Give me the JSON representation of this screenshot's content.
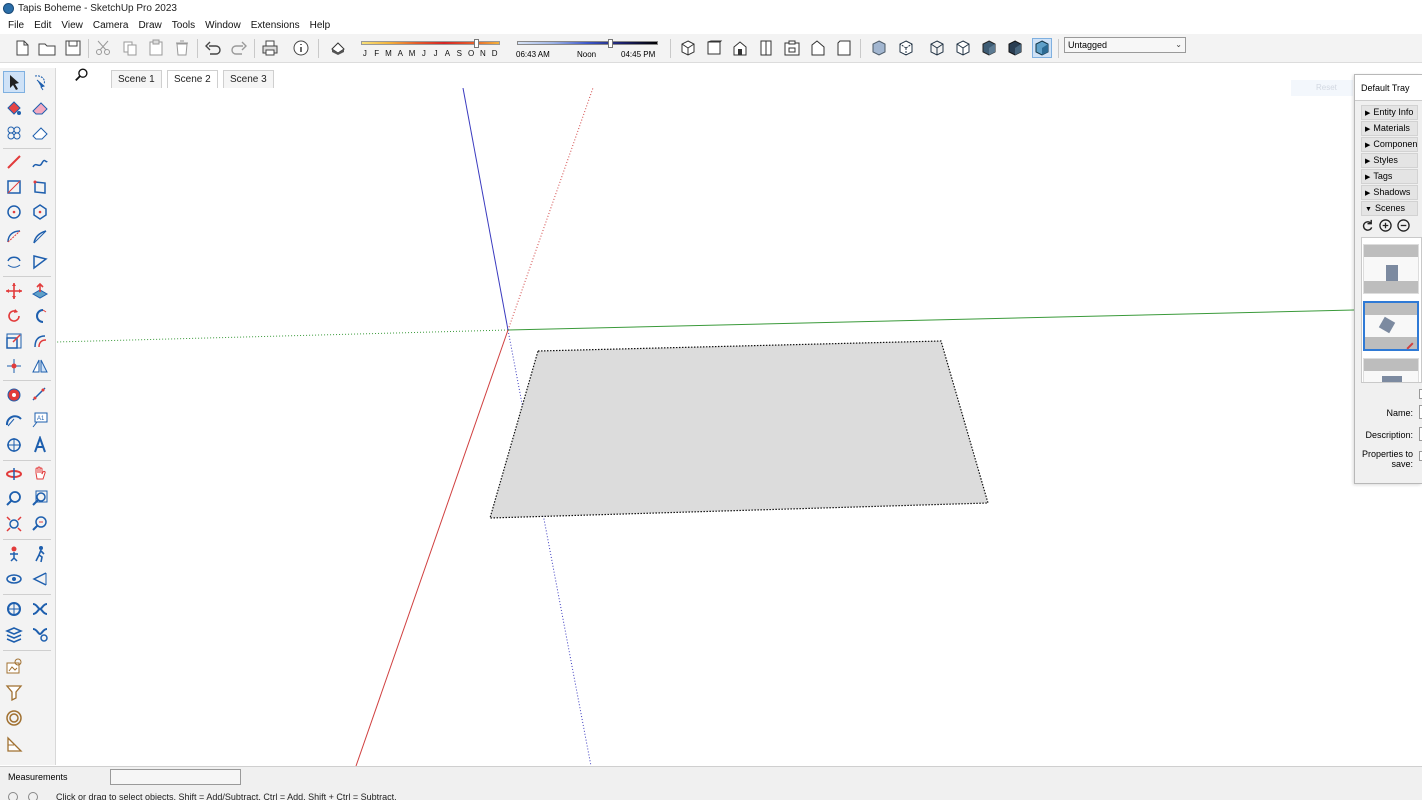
{
  "window": {
    "title": "Tapis Boheme - SketchUp Pro 2023"
  },
  "menubar": {
    "items": [
      "File",
      "Edit",
      "View",
      "Camera",
      "Draw",
      "Tools",
      "Window",
      "Extensions",
      "Help"
    ]
  },
  "toolbar": {
    "months": [
      "J",
      "F",
      "M",
      "A",
      "M",
      "J",
      "J",
      "A",
      "S",
      "O",
      "N",
      "D"
    ],
    "month_position": 0.83,
    "time_start": "06:43 AM",
    "time_noon": "Noon",
    "time_end": "04:45 PM",
    "time_position": 0.66,
    "tag_value": "Untagged"
  },
  "scene_tabs": [
    {
      "label": "Scene 1"
    },
    {
      "label": "Scene 2"
    },
    {
      "label": "Scene 3"
    }
  ],
  "active_scene": "Scene 2",
  "tray": {
    "title": "Default Tray",
    "panels": [
      "Entity Info",
      "Materials",
      "Components",
      "Styles",
      "Tags",
      "Shadows",
      "Scenes"
    ],
    "expanded_panel": "Scenes",
    "fields": {
      "name_label": "Name:",
      "description_label": "Description:",
      "properties_label": "Properties to save:"
    },
    "faded_button": "Reset"
  },
  "status": {
    "measurements_label": "Measurements",
    "hint": "Click or drag to select objects. Shift = Add/Subtract. Ctrl = Add. Shift + Ctrl = Subtract."
  },
  "colors": {
    "x_axis": "#d04040",
    "y_axis": "#3a9a3a",
    "z_axis": "#3b3bbf",
    "face": "#dcdcdc",
    "selection": "#2f7ad6"
  }
}
